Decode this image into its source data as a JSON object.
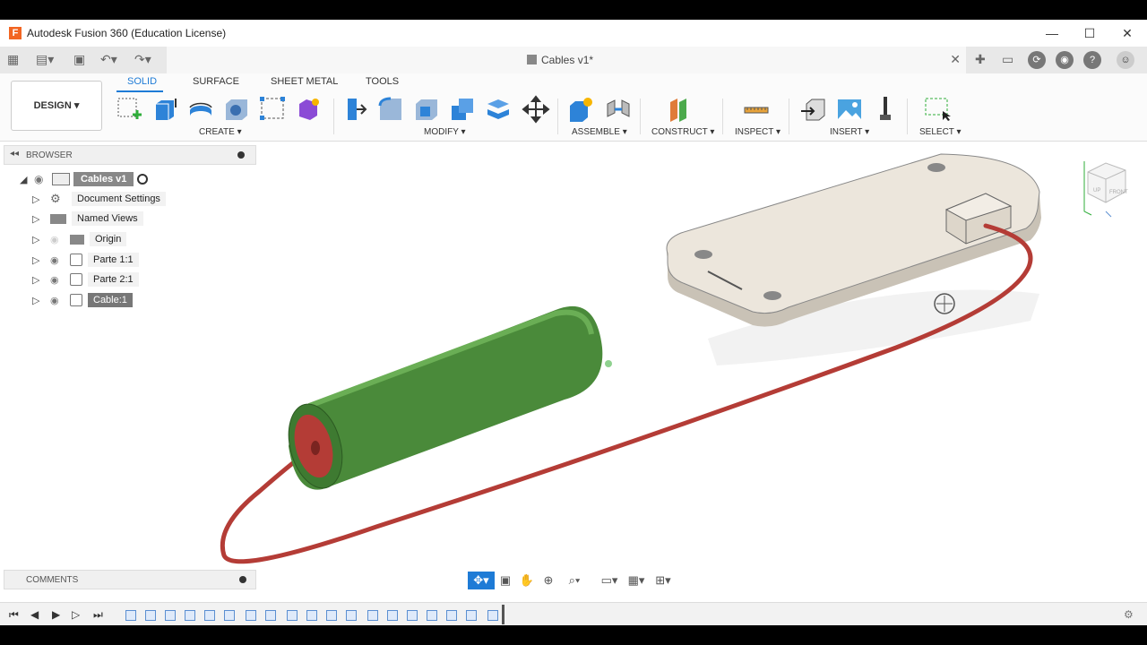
{
  "window": {
    "title": "Autodesk Fusion 360 (Education License)",
    "logo_letter": "F"
  },
  "document": {
    "tab_name": "Cables v1*"
  },
  "ribbon": {
    "workspace": "DESIGN ▾",
    "tabs": [
      "SOLID",
      "SURFACE",
      "SHEET METAL",
      "TOOLS"
    ],
    "groups": [
      "CREATE ▾",
      "MODIFY ▾",
      "ASSEMBLE ▾",
      "CONSTRUCT ▾",
      "INSPECT ▾",
      "INSERT ▾",
      "SELECT ▾"
    ]
  },
  "browser": {
    "title": "BROWSER",
    "root": "Cables v1",
    "items": [
      {
        "label": "Document Settings",
        "icon": "gear-icon"
      },
      {
        "label": "Named Views",
        "icon": "folder-icon"
      },
      {
        "label": "Origin",
        "icon": "folder-icon"
      },
      {
        "label": "Parte 1:1",
        "icon": "component-icon"
      },
      {
        "label": "Parte 2:1",
        "icon": "component-icon"
      },
      {
        "label": "Cable:1",
        "icon": "component-icon"
      }
    ]
  },
  "comments": {
    "title": "COMMENTS"
  },
  "colors": {
    "accent": "#1e7bd6",
    "cylinder": "#4a8a3a",
    "cable": "#b43c36",
    "plate": "#ece6dc"
  }
}
